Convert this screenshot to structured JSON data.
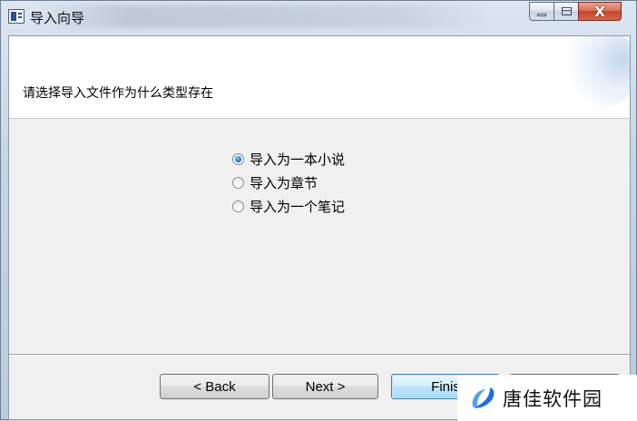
{
  "window": {
    "title": "导入向导",
    "close_glyph": "X"
  },
  "header": {
    "prompt": "请选择导入文件作为什么类型存在"
  },
  "options": [
    {
      "label": "导入为一本小说",
      "checked": true
    },
    {
      "label": "导入为章节",
      "checked": false
    },
    {
      "label": "导入为一个笔记",
      "checked": false
    }
  ],
  "buttons": {
    "back": "< Back",
    "next": "Next >",
    "finish": "Finis",
    "cancel": ""
  },
  "watermark": {
    "text": "唐佳软件园"
  },
  "colors": {
    "accent": "#1f6fc4",
    "finish_border": "#3c7fb1",
    "close_red": "#c2452b"
  }
}
